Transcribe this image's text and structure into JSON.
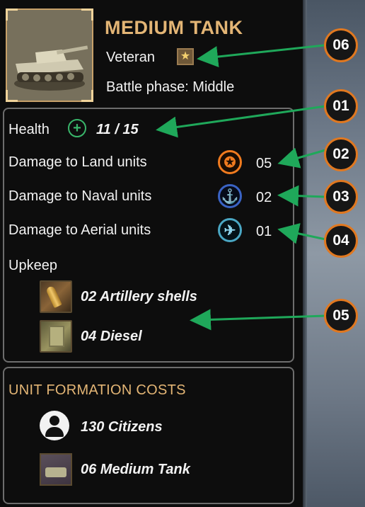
{
  "unit": {
    "name": "MEDIUM TANK",
    "rank": "Veteran",
    "rank_icon": "star-badge-icon",
    "battle_phase": "Battle phase: Middle"
  },
  "stats": {
    "health_label": "Health",
    "health_value": "11 / 15",
    "land_label": "Damage to Land units",
    "land_value": "05",
    "naval_label": "Damage to Naval units",
    "naval_value": "02",
    "aerial_label": "Damage to Aerial units",
    "aerial_value": "01",
    "upkeep_label": "Upkeep",
    "upkeep_items": [
      {
        "text": "02 Artillery shells",
        "icon": "artillery-shell-icon"
      },
      {
        "text": "04 Diesel",
        "icon": "diesel-canister-icon"
      }
    ]
  },
  "costs": {
    "title": "UNIT FORMATION COSTS",
    "items": [
      {
        "text": "130 Citizens",
        "icon": "citizens-icon"
      },
      {
        "text": "06 Medium Tank",
        "icon": "medium-tank-icon"
      }
    ]
  },
  "callouts": [
    "06",
    "01",
    "02",
    "03",
    "04",
    "05"
  ],
  "colors": {
    "accent_gold": "#e3b575",
    "callout_border": "#e07820",
    "arrow_green": "#1fa85a",
    "health_green": "#39b56a",
    "land_orange": "#f07b1f",
    "naval_blue": "#3a63c4",
    "aerial_cyan": "#4aa7c4"
  }
}
